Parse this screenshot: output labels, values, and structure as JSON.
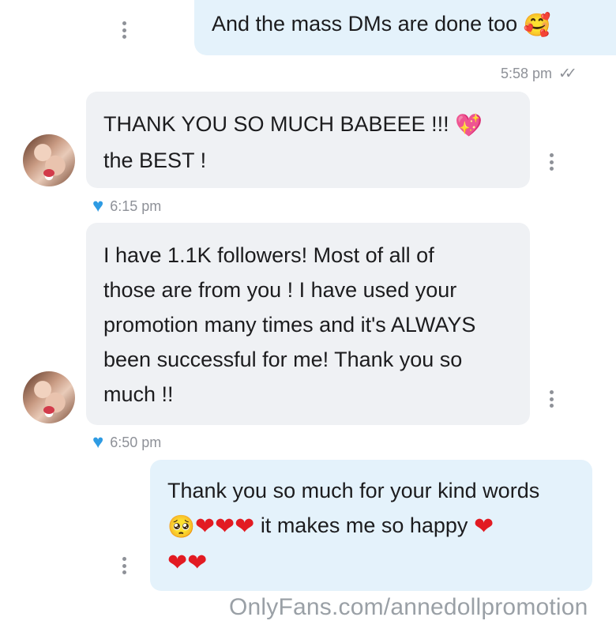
{
  "messages": [
    {
      "sender": "me",
      "lines": [
        "And the mass DMs are done too"
      ],
      "emoji": [
        "smiling-face-with-hearts"
      ],
      "time": "5:58 pm",
      "status": "read-double-check"
    },
    {
      "sender": "contact",
      "lines": [
        "THANK YOU SO MUCH BABEEE !!!",
        "the BEST !"
      ],
      "emoji": [
        "sparkling-heart"
      ],
      "time": "6:15 pm",
      "liked": true
    },
    {
      "sender": "contact",
      "lines": [
        "I have 1.1K followers! Most of all of",
        "those are from you ! I have used your",
        "promotion many times and it's ALWAYS",
        "been successful for me! Thank you so",
        "much !!"
      ],
      "time": "6:50 pm",
      "liked": true
    },
    {
      "sender": "me",
      "lines": [
        "Thank you so much for your kind words",
        "it makes me so happy"
      ],
      "emoji": [
        "pleading-face",
        "red-heart",
        "red-heart",
        "red-heart",
        "red-heart",
        "red-heart",
        "red-heart"
      ]
    }
  ],
  "watermark": "OnlyFans.com/annedollpromotion",
  "colors": {
    "outgoing_bubble": "#e4f2fb",
    "incoming_bubble": "#eff1f4",
    "like_heart": "#2e9be3",
    "meta_text": "#8e9198"
  }
}
